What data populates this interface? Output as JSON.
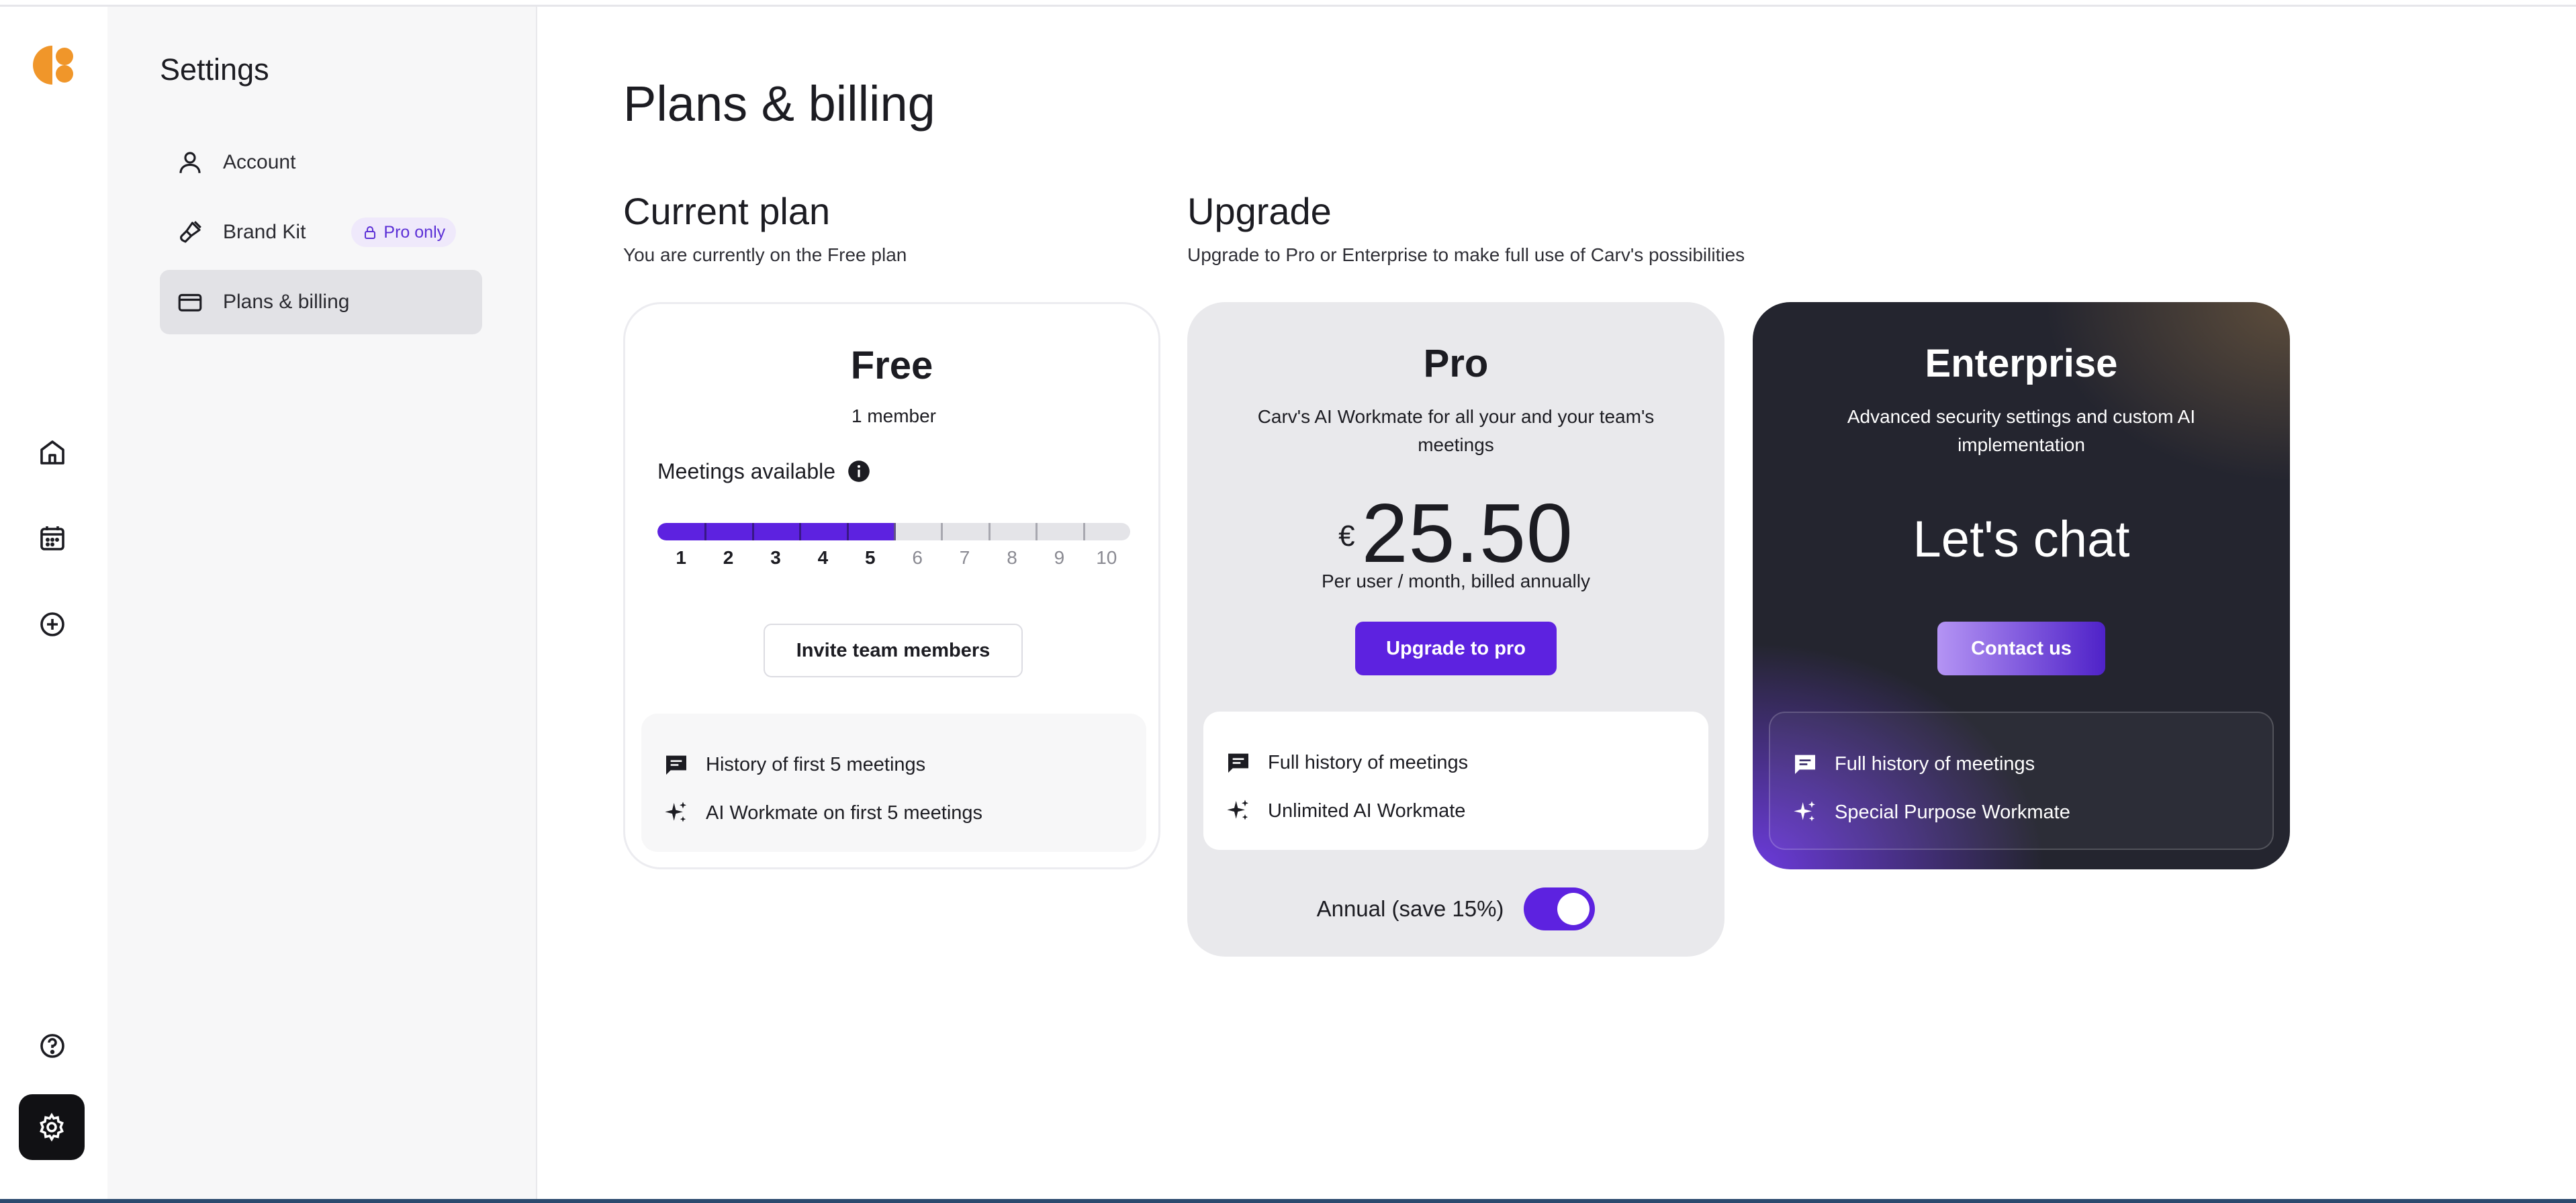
{
  "settings": {
    "title": "Settings",
    "nav": [
      {
        "label": "Account",
        "icon": "user-icon"
      },
      {
        "label": "Brand Kit",
        "icon": "brush-icon",
        "badge": "Pro only"
      },
      {
        "label": "Plans & billing",
        "icon": "credit-card-icon",
        "active": true
      }
    ]
  },
  "rail": {
    "icons": [
      "home-icon",
      "calendar-icon",
      "add-circle-icon",
      "help-icon",
      "gear-icon"
    ]
  },
  "main": {
    "title": "Plans & billing",
    "current": {
      "title": "Current plan",
      "subtitle": "You are currently on the Free plan"
    },
    "upgrade": {
      "title": "Upgrade",
      "subtitle": "Upgrade to Pro or Enterprise to make full use of Carv's possibilities"
    }
  },
  "plans": {
    "free": {
      "name": "Free",
      "members": "1 member",
      "meetings_label": "Meetings available",
      "meetings_used": 5,
      "meetings_total": 10,
      "scale": [
        "1",
        "2",
        "3",
        "4",
        "5",
        "6",
        "7",
        "8",
        "9",
        "10"
      ],
      "button": "Invite team members",
      "features": [
        "History of first 5 meetings",
        "AI Workmate on first 5 meetings"
      ]
    },
    "pro": {
      "name": "Pro",
      "description": "Carv's AI Workmate for all your and your team's meetings",
      "currency": "€",
      "price": "25.50",
      "price_note": "Per user / month, billed annually",
      "button": "Upgrade to pro",
      "features": [
        "Full history of meetings",
        "Unlimited AI Workmate"
      ],
      "toggle_label": "Annual (save 15%)",
      "toggle_on": true
    },
    "enterprise": {
      "name": "Enterprise",
      "description": "Advanced security settings and custom AI implementation",
      "headline": "Let's chat",
      "button": "Contact us",
      "features": [
        "Full history of meetings",
        "Special Purpose Workmate"
      ]
    }
  },
  "colors": {
    "accent": "#5d22e0",
    "logo": "#f0962a",
    "enterprise_bg": "#24252f"
  }
}
